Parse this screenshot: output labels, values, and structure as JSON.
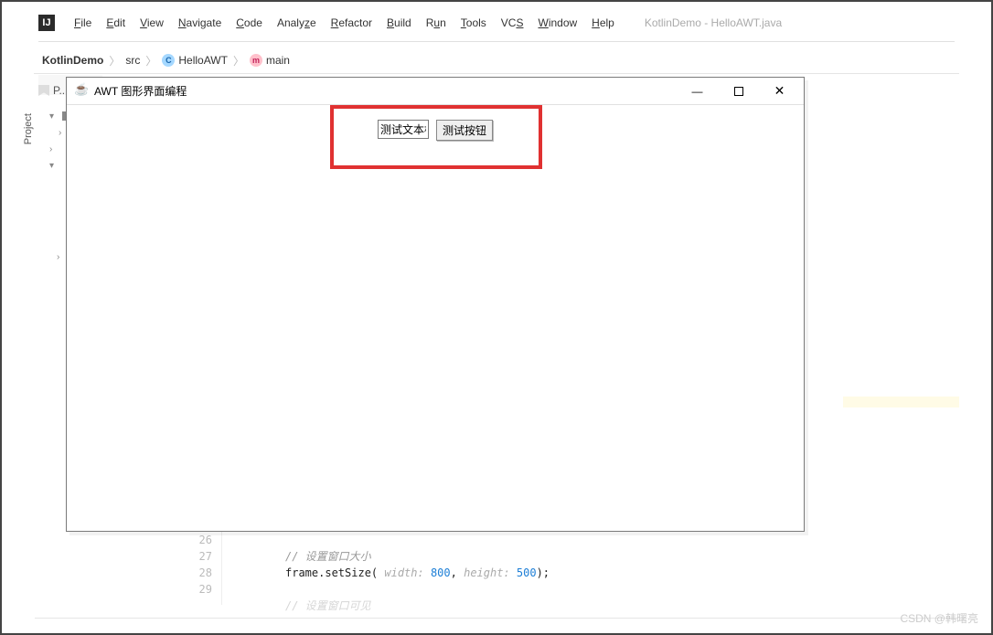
{
  "ide": {
    "menus": [
      "File",
      "Edit",
      "View",
      "Navigate",
      "Code",
      "Analyze",
      "Refactor",
      "Build",
      "Run",
      "Tools",
      "VCS",
      "Window",
      "Help"
    ],
    "window_title": "KotlinDemo - HelloAWT.java"
  },
  "breadcrumb": {
    "items": [
      "KotlinDemo",
      "src",
      "HelloAWT",
      "main"
    ]
  },
  "sidebar": {
    "label": "Project",
    "tab_label": "P..."
  },
  "tree": {
    "rows": [
      "▾",
      "›",
      "›",
      "▾"
    ],
    "extra_rows": [
      "›"
    ]
  },
  "awt": {
    "title": "AWT 图形界面编程",
    "textfield_value": "测试文本框",
    "button_label": "测试按钮"
  },
  "code": {
    "line_numbers": [
      "26",
      "27",
      "28",
      "29"
    ],
    "line27_comment": "// 设置窗口大小",
    "line28_call": "frame.setSize(",
    "line28_hint1": " width: ",
    "line28_arg1": "800",
    "line28_sep": ", ",
    "line28_hint2": " height: ",
    "line28_arg2": "500",
    "line28_end": ");",
    "line30_partial": "//  设置窗口可见"
  },
  "watermark": "CSDN @韩曙亮"
}
